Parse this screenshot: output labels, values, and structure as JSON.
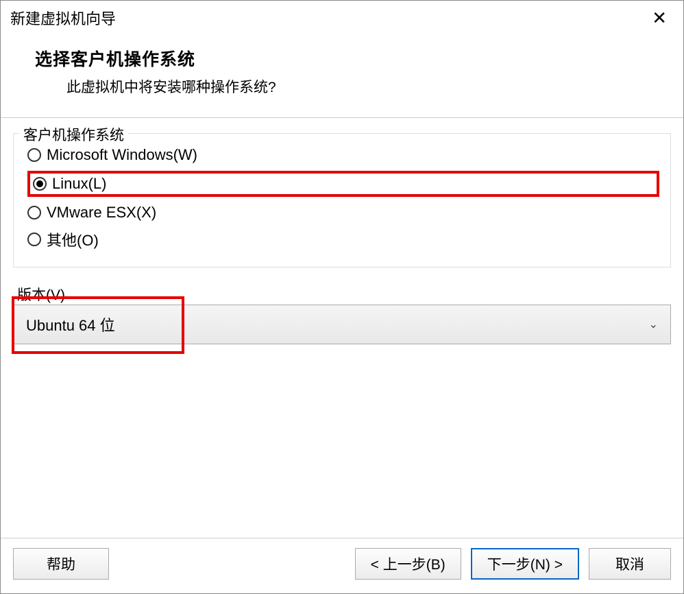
{
  "titlebar": {
    "title": "新建虚拟机向导"
  },
  "header": {
    "title": "选择客户机操作系统",
    "subtitle": "此虚拟机中将安装哪种操作系统?"
  },
  "os_group": {
    "legend": "客户机操作系统",
    "options": [
      {
        "label": "Microsoft Windows(W)",
        "selected": false
      },
      {
        "label": "Linux(L)",
        "selected": true
      },
      {
        "label": "VMware ESX(X)",
        "selected": false
      },
      {
        "label": "其他(O)",
        "selected": false
      }
    ]
  },
  "version": {
    "label": "版本(V)",
    "selected": "Ubuntu 64 位"
  },
  "footer": {
    "help": "帮助",
    "back": "< 上一步(B)",
    "next": "下一步(N) >",
    "cancel": "取消"
  }
}
